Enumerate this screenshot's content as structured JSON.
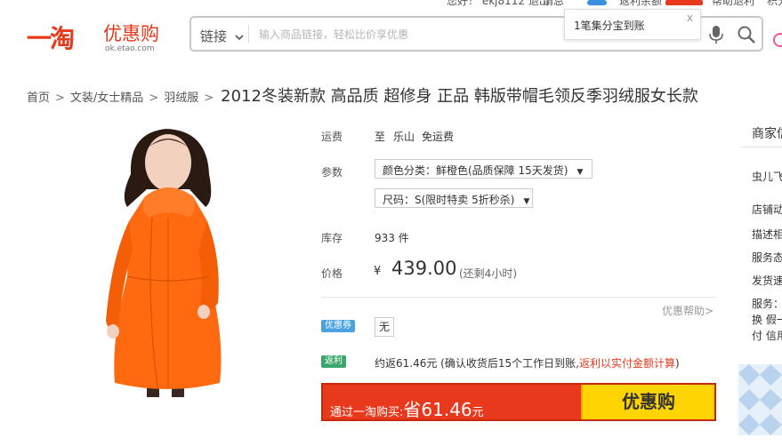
{
  "header": {
    "logo_main": "一淘",
    "logo_sub": "优惠购",
    "logo_url": "ok.etao.com",
    "top_links": [
      "您好！ ekj8112 退出",
      "消息",
      "返利余额",
      "帮助退利",
      "积分"
    ],
    "search": {
      "scope_label": "链接",
      "placeholder": "输入商品链接，轻松比价享优惠"
    },
    "popup": {
      "text": "1笔集分宝到账",
      "close": "x"
    }
  },
  "breadcrumb": {
    "items": [
      "首页",
      "文装/女士精品",
      "羽绒服"
    ],
    "separator": ">",
    "title": "2012冬装新款 高品质 超修身 正品 韩版带帽毛领反季羽绒服女长款"
  },
  "product": {
    "shipping": {
      "label": "运费",
      "to": "至",
      "city": "乐山",
      "fee": "免运费"
    },
    "params": {
      "label": "参数",
      "color": "颜色分类：鲜橙色(品质保障 15天发货)",
      "size": "尺码：S(限时特卖 5折秒杀)"
    },
    "stock": {
      "label": "库存",
      "value": "933 件"
    },
    "price": {
      "label": "价格",
      "currency": "¥",
      "value": "439.00",
      "note": "(还剩4小时)"
    },
    "help_link": "优惠帮助>",
    "coupon": {
      "tag": "优惠券",
      "value": "无"
    },
    "rebate": {
      "tag": "返利",
      "prefix": "约返61.46元 (确认收货后15个工作日到账,",
      "highlight": "返利以实付金额计算",
      "suffix": ")"
    },
    "buy_bar": {
      "text_before": "通过一淘购买:",
      "save_word": "省61.46",
      "unit": "元",
      "button": "优惠购"
    }
  },
  "sidebar": {
    "title": "商家信",
    "shop": "虫儿飞",
    "rows": [
      "店铺动",
      "描述相",
      "服务态",
      "发货速"
    ],
    "service_label": "服务：",
    "service_lines": [
      "换 假一",
      "付 信用"
    ]
  },
  "colors": {
    "brand_red": "#e8391d",
    "button_yellow": "#ffd400",
    "coupon_blue": "#4aa3e0",
    "rebate_green": "#3aa86b",
    "coat_orange": "#ff6a10"
  }
}
